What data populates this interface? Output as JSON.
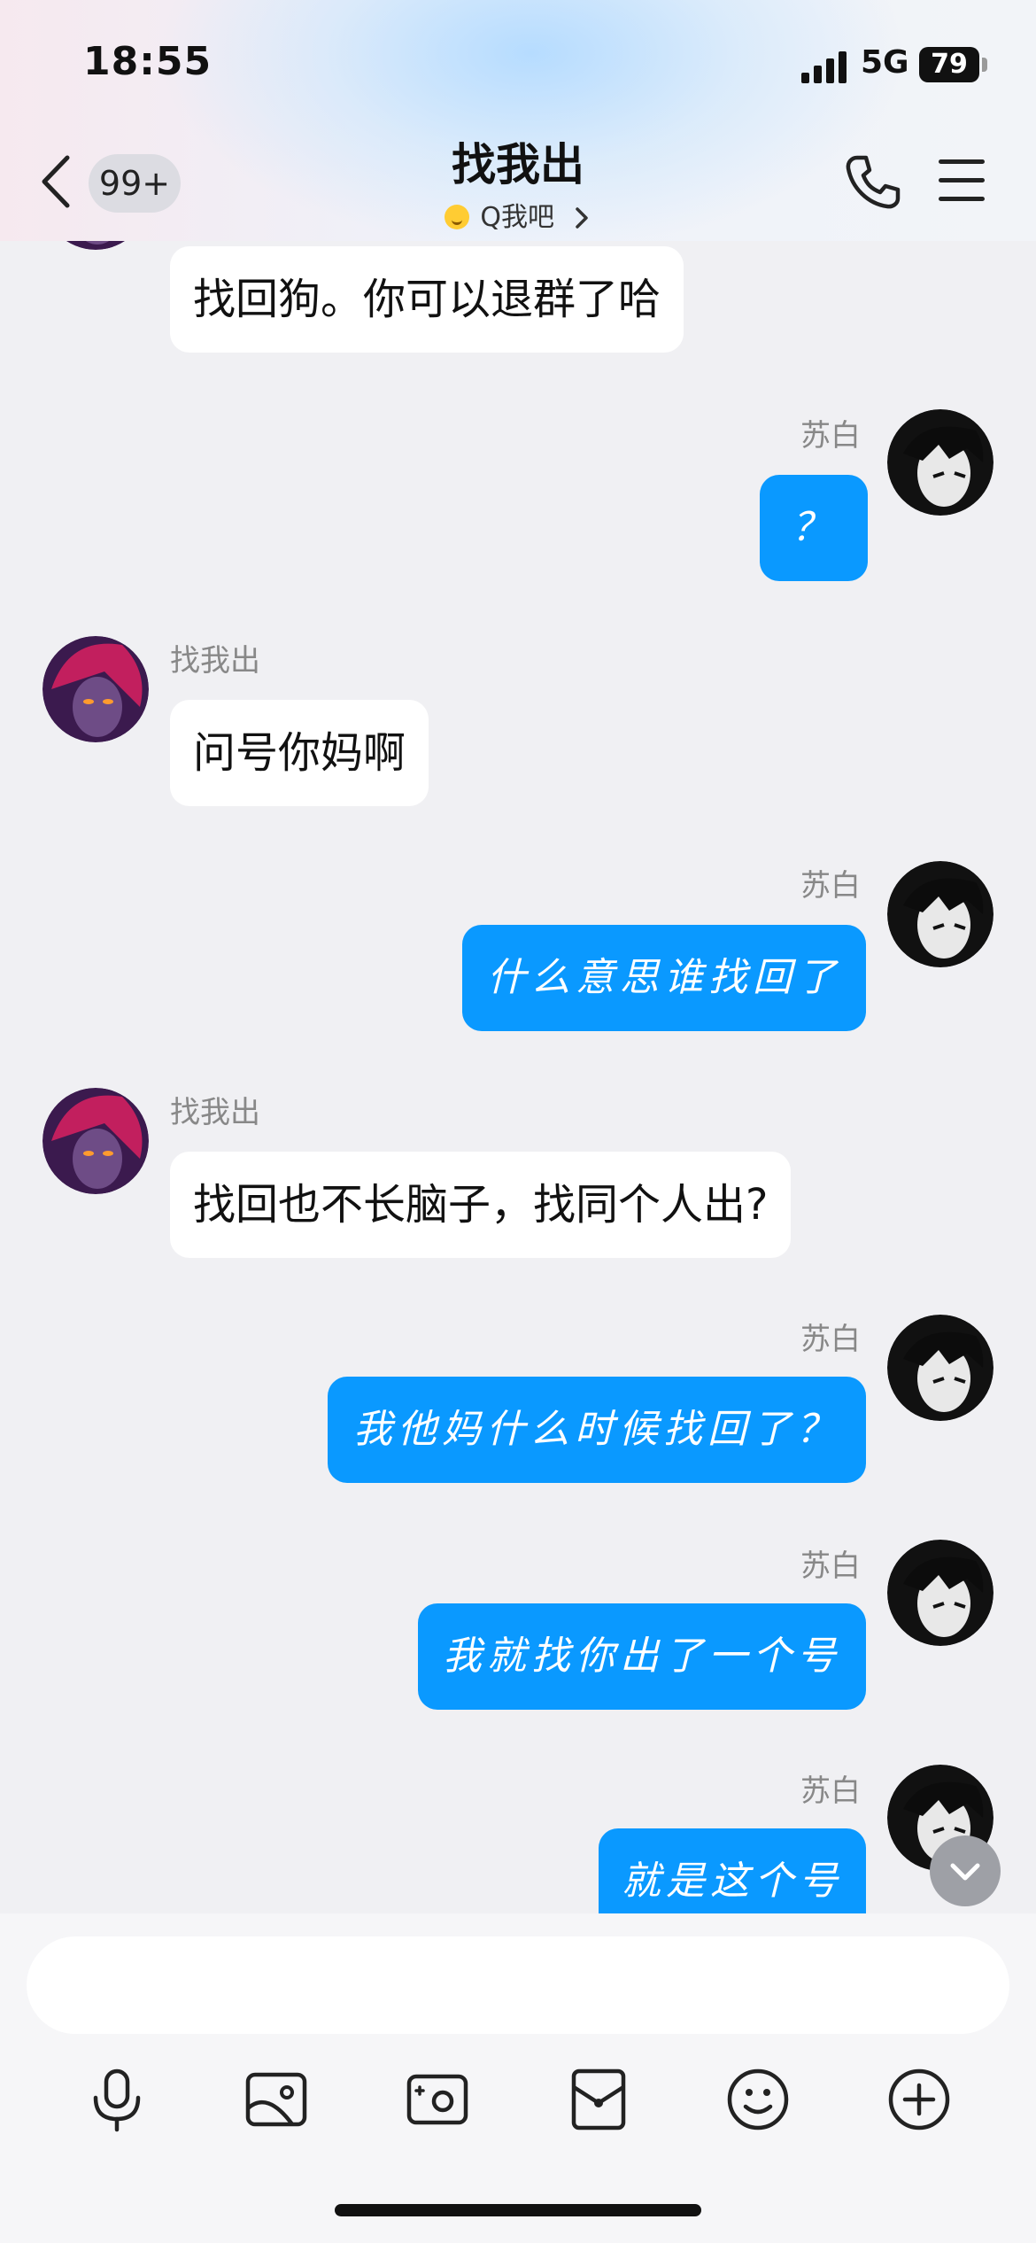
{
  "status_bar": {
    "time": "18:55",
    "network": "5G",
    "battery": "79"
  },
  "header": {
    "back_badge": "99+",
    "title": "找我出",
    "subtitle": "Q我吧"
  },
  "colors": {
    "outgoing_bubble": "#0a99ff",
    "incoming_bubble": "#ffffff",
    "background": "#f0f0f3"
  },
  "messages": [
    {
      "side": "in",
      "sender": "",
      "text": "找回狗。你可以退群了哈"
    },
    {
      "side": "out",
      "sender": "苏白",
      "text": "？"
    },
    {
      "side": "in",
      "sender": "找我出",
      "text": "问号你妈啊"
    },
    {
      "side": "out",
      "sender": "苏白",
      "text": "什么意思谁找回了"
    },
    {
      "side": "in",
      "sender": "找我出",
      "text": "找回也不长脑子，找同个人出?"
    },
    {
      "side": "out",
      "sender": "苏白",
      "text": "我他妈什么时候找回了？"
    },
    {
      "side": "out",
      "sender": "苏白",
      "text": "我就找你出了一个号"
    },
    {
      "side": "out",
      "sender": "苏白",
      "text": "就是这个号"
    }
  ],
  "composer": {
    "input_value": "",
    "tools": [
      "microphone-icon",
      "image-icon",
      "camera-icon",
      "red-packet-icon",
      "emoji-icon",
      "plus-icon"
    ]
  }
}
